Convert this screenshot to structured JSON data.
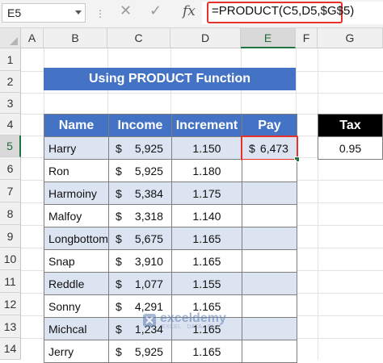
{
  "formula_bar": {
    "name_box": "E5",
    "cancel_glyph": "✕",
    "enter_glyph": "✓",
    "fx_label": "fx",
    "formula": "=PRODUCT(C5,D5,$G$5)"
  },
  "columns": [
    "A",
    "B",
    "C",
    "D",
    "E",
    "F",
    "G"
  ],
  "active_column": "E",
  "rows": [
    "1",
    "2",
    "3",
    "4",
    "5",
    "6",
    "7",
    "8",
    "9",
    "10",
    "11",
    "12",
    "13",
    "14"
  ],
  "active_row": "5",
  "title": "Using PRODUCT Function",
  "table": {
    "headers": [
      "Name",
      "Income",
      "Increment",
      "Pay"
    ],
    "currency_symbol": "$",
    "rows": [
      {
        "name": "Harry",
        "income": "5,925",
        "increment": "1.150",
        "pay": "6,473"
      },
      {
        "name": "Ron",
        "income": "5,925",
        "increment": "1.180",
        "pay": ""
      },
      {
        "name": "Harmoiny",
        "income": "5,384",
        "increment": "1.175",
        "pay": ""
      },
      {
        "name": "Malfoy",
        "income": "3,318",
        "increment": "1.140",
        "pay": ""
      },
      {
        "name": "Longbottom",
        "income": "5,675",
        "increment": "1.165",
        "pay": ""
      },
      {
        "name": "Snap",
        "income": "3,910",
        "increment": "1.165",
        "pay": ""
      },
      {
        "name": "Reddle",
        "income": "1,077",
        "increment": "1.155",
        "pay": ""
      },
      {
        "name": "Sonny",
        "income": "4,291",
        "increment": "1.165",
        "pay": ""
      },
      {
        "name": "Michcal",
        "income": "1,234",
        "increment": "1.165",
        "pay": ""
      },
      {
        "name": "Jerry",
        "income": "5,925",
        "increment": "1.165",
        "pay": ""
      }
    ]
  },
  "tax": {
    "header": "Tax",
    "value": "0.95"
  },
  "watermark": {
    "name": "exceldemy",
    "tagline": "EXCEL · DATA · BI"
  },
  "colors": {
    "accent_blue": "#4472c4",
    "band_blue": "#dce3f1",
    "highlight_red": "#e8312b",
    "excel_green": "#217346"
  }
}
